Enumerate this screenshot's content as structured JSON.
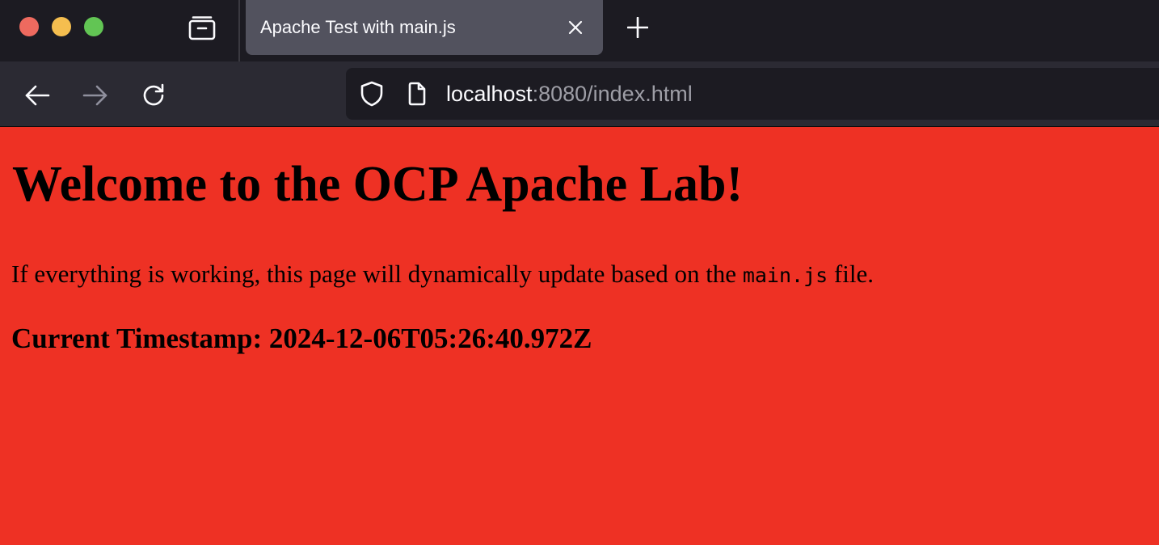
{
  "window": {
    "colors": {
      "close": "#ee6a5f",
      "minimize": "#f5be4f",
      "maximize": "#62c554",
      "chrome_dark": "#1c1b22",
      "toolbar": "#2b2a33",
      "active_tab": "#52525e"
    }
  },
  "tabs": {
    "tab_list_icon": "tab-list-icon",
    "active": {
      "title": "Apache Test with main.js",
      "close_icon": "close-icon"
    },
    "new_tab_icon": "plus-icon"
  },
  "navigation": {
    "back_icon": "arrow-left-icon",
    "forward_icon": "arrow-right-icon",
    "forward_enabled": false,
    "reload_icon": "reload-icon"
  },
  "address_bar": {
    "security_icon": "shield-icon",
    "page_icon": "page-icon",
    "host": "localhost",
    "rest": ":8080/index.html"
  },
  "page": {
    "background": "#ee3124",
    "heading": "Welcome to the OCP Apache Lab!",
    "intro_before": "If everything is working, this page will dynamically update based on the ",
    "intro_code": "main.js",
    "intro_after": " file.",
    "timestamp_label": "Current Timestamp: ",
    "timestamp_value": "2024-12-06T05:26:40.972Z"
  }
}
